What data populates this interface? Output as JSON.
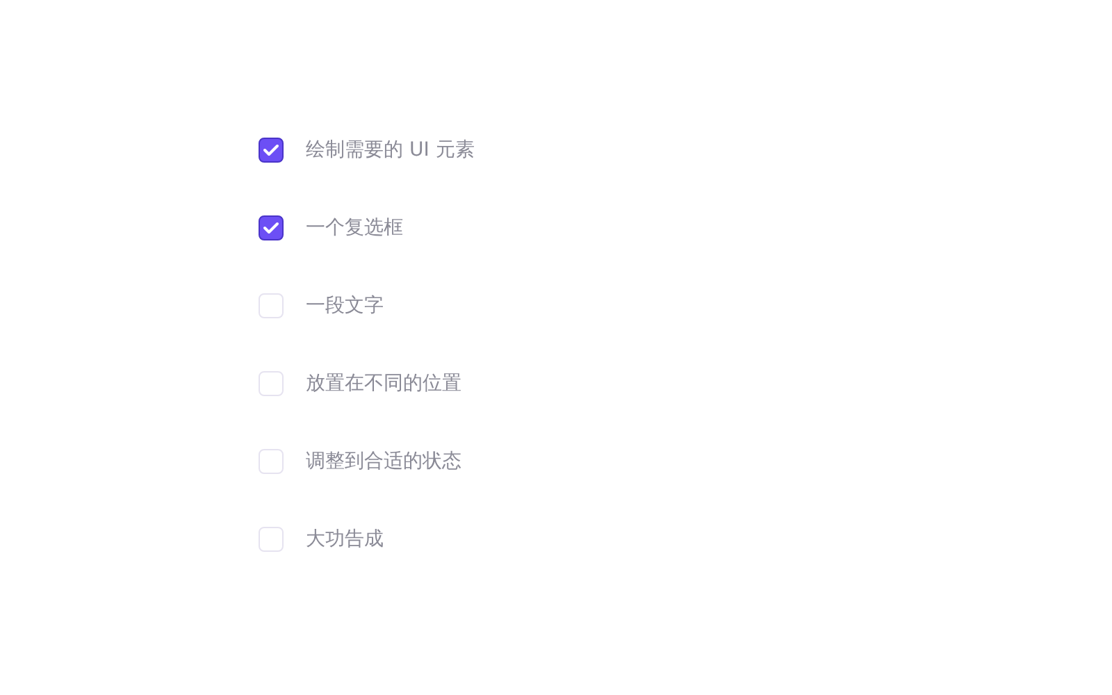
{
  "checklist": [
    {
      "label": "绘制需要的 UI 元素",
      "checked": true
    },
    {
      "label": "一个复选框",
      "checked": true
    },
    {
      "label": "一段文字",
      "checked": false
    },
    {
      "label": "放置在不同的位置",
      "checked": false
    },
    {
      "label": "调整到合适的状态",
      "checked": false
    },
    {
      "label": "大功告成",
      "checked": false
    }
  ]
}
